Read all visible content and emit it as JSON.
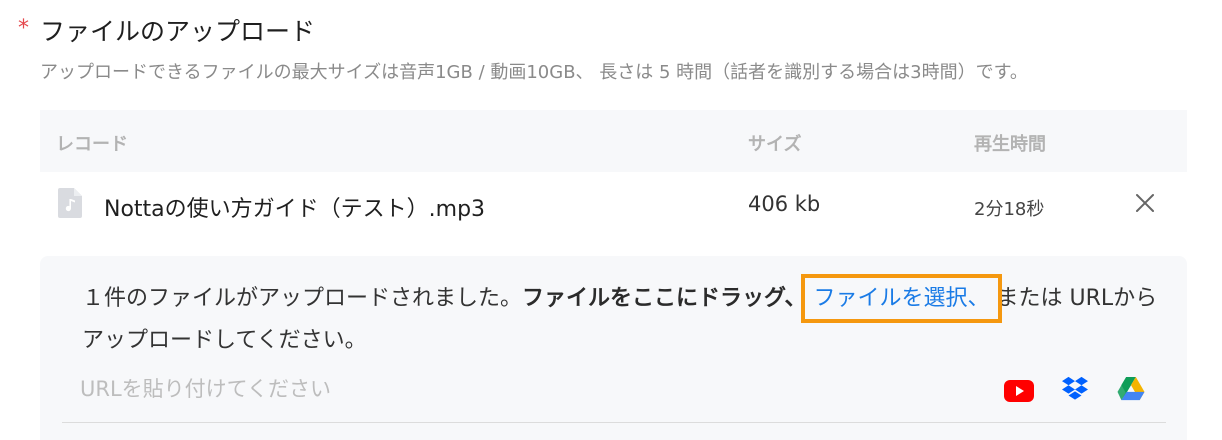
{
  "header": {
    "required_mark": "*",
    "title": "ファイルのアップロード",
    "subtitle": "アップロードできるファイルの最大サイズは音声1GB / 動画10GB、 長さは 5 時間（話者を識別する場合は3時間）です。"
  },
  "table": {
    "columns": [
      "レコード",
      "サイズ",
      "再生時間"
    ],
    "rows": [
      {
        "name": "Nottaの使い方ガイド（テスト）.mp3",
        "size": "406 kb",
        "duration": "2分18秒"
      }
    ]
  },
  "dropzone": {
    "msg_prefix": "１件のファイルがアップロードされました。",
    "msg_bold": "ファイルをここにドラッグ、",
    "msg_link": "ファイルを選択、",
    "msg_suffix": "または URLからアップロードしてください。",
    "url_placeholder": "URLを貼り付けてください"
  },
  "services": [
    "youtube-icon",
    "dropbox-icon",
    "google-drive-icon"
  ],
  "colors": {
    "accent_link": "#1a7be6",
    "highlight_box": "#f5980f",
    "required": "#e5484d",
    "youtube": "#ff0000",
    "dropbox": "#0061fe"
  }
}
